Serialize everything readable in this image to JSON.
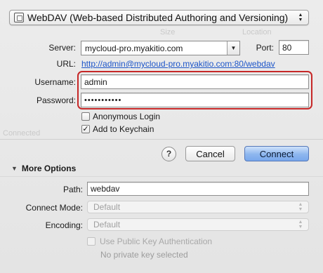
{
  "protocol": {
    "label": "WebDAV (Web-based Distributed Authoring and Versioning)",
    "icon": "disk-icon"
  },
  "background_ghost": {
    "row1": "Size",
    "row2": "Location",
    "row3": "Connected"
  },
  "server": {
    "label": "Server:",
    "value": "mycloud-pro.myakitio.com"
  },
  "port": {
    "label": "Port:",
    "value": "80"
  },
  "url": {
    "label": "URL:",
    "value": "http://admin@mycloud-pro.myakitio.com:80/webdav"
  },
  "username": {
    "label": "Username:",
    "value": "admin"
  },
  "password": {
    "label": "Password:",
    "value": "•••••••••••"
  },
  "options": {
    "anonymous": {
      "label": "Anonymous Login",
      "checked": false
    },
    "keychain": {
      "label": "Add to Keychain",
      "checked": true
    }
  },
  "buttons": {
    "help": "?",
    "cancel": "Cancel",
    "connect": "Connect"
  },
  "more_options": {
    "label": "More Options",
    "path": {
      "label": "Path:",
      "value": "webdav"
    },
    "connect_mode": {
      "label": "Connect Mode:",
      "value": "Default"
    },
    "encoding": {
      "label": "Encoding:",
      "value": "Default"
    },
    "public_key": {
      "label": "Use Public Key Authentication",
      "checked": false
    },
    "no_key": "No private key selected"
  },
  "colors": {
    "highlight": "#c62828",
    "link": "#1c55c9",
    "primary_button": "#79a8ec"
  }
}
